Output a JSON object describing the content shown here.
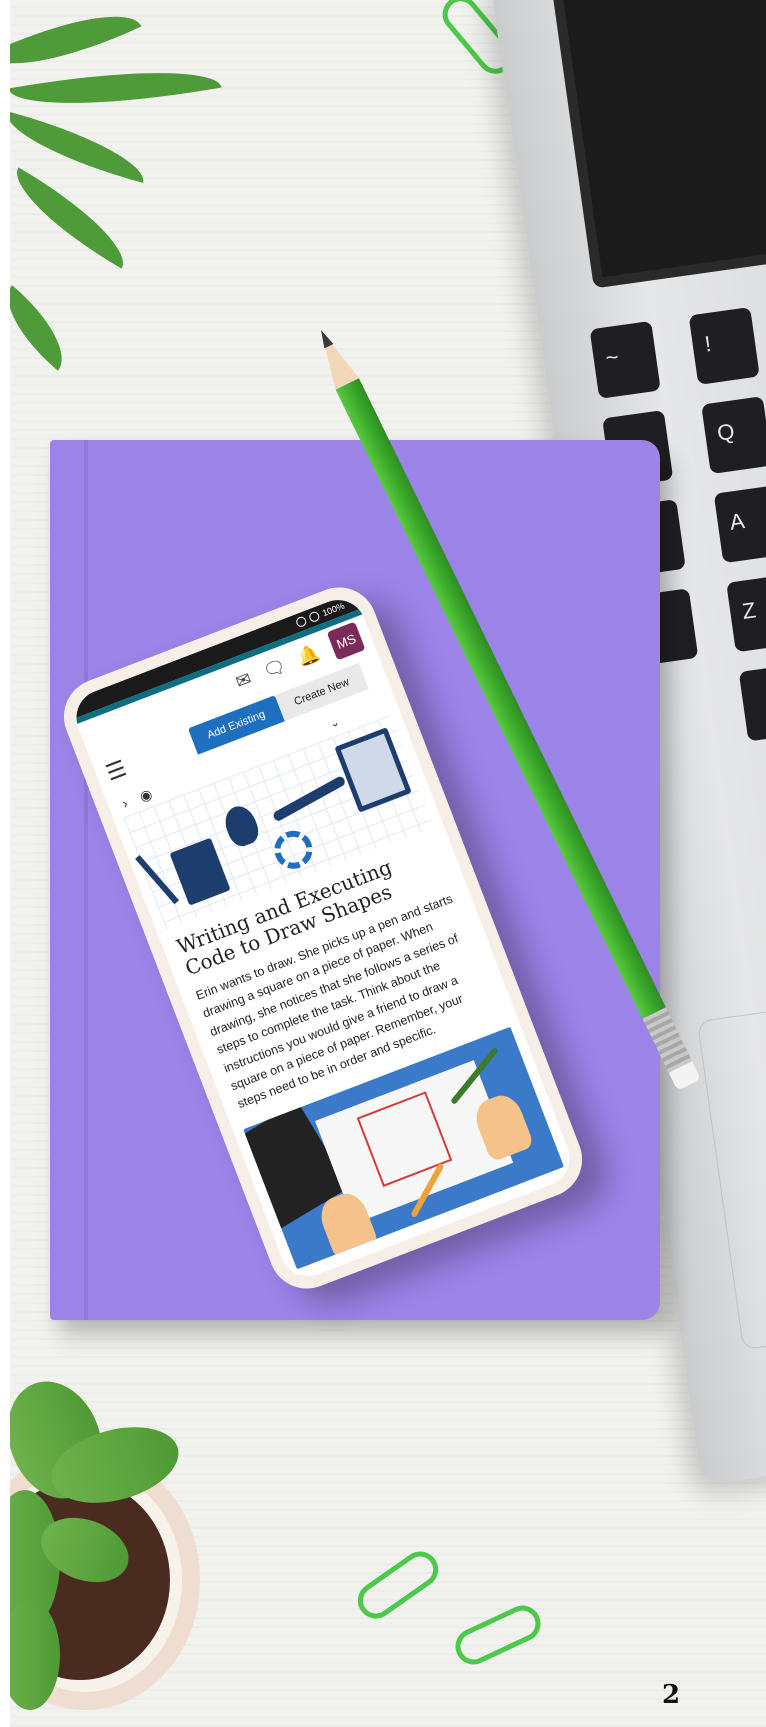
{
  "phone": {
    "status": {
      "battery": "100%"
    },
    "header": {
      "icons": [
        "mail-icon",
        "chat-icon",
        "bell-icon",
        "chevron-down-icon"
      ],
      "avatar_initials": "MS",
      "menu_icon": "hamburger-icon"
    },
    "buttons": {
      "add_existing": "Add Existing",
      "create_new": "Create New"
    },
    "toolbar": {
      "chevron": "›",
      "eye": "◉"
    },
    "lesson": {
      "title": "Writing and Executing Code to Draw Shapes",
      "body": "Erin wants to draw. She picks up a pen and starts drawing a square on a piece of paper. When drawing, she notices that she follows a series of steps to complete the task. Think about the instructions you would give a friend to draw a square on a piece of paper. Remember, your steps need to be in order and specific."
    }
  },
  "page_number": "2",
  "colors": {
    "notebook": "#9b83e8",
    "pencil": "#3aa62a",
    "avatar": "#7a2b5a",
    "primary_button": "#1f6fc0",
    "teal_bar": "#0f6f82"
  }
}
